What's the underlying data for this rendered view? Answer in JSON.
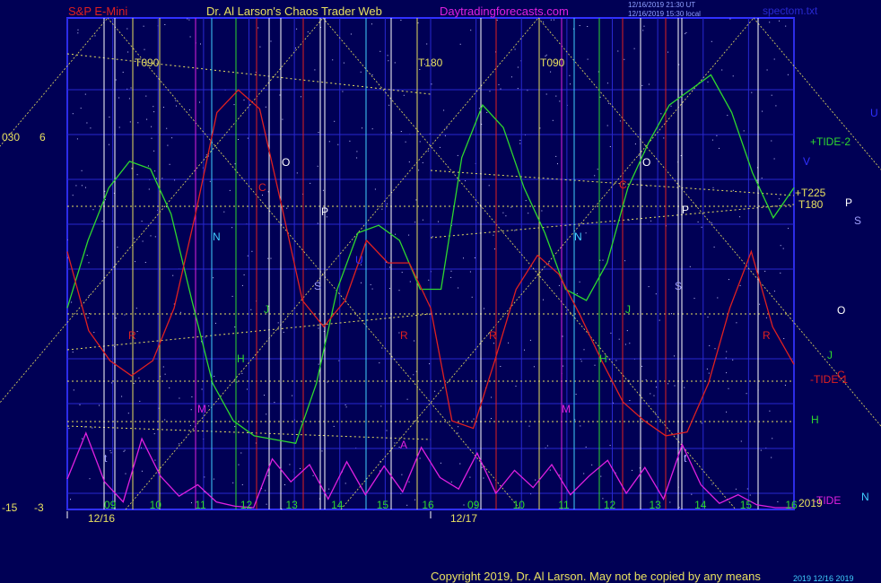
{
  "header": {
    "symbol": "S&P E-Mini",
    "title": "Dr. Al Larson's Chaos Trader Web",
    "site": "Daytradingforecasts.com",
    "stamp_line1": "12/16/2019 21:30 UT",
    "stamp_line2": "12/16/2019 15:30 local",
    "file": "spectom.txt"
  },
  "footer": {
    "copyright": "Copyright 2019, Dr. Al Larson. May not be copied by any means",
    "stamp": "2019 12/16 2019"
  },
  "colors": {
    "background": "#000055",
    "plot_border": "#3030ff",
    "grid_blue": "#2828d0",
    "green_tide": "#2ed82e",
    "red_price": "#e02020",
    "magenta_cycle": "#e020e0",
    "yellow": "#e8e060",
    "cyan": "#40d0ff",
    "white": "#ffffff"
  },
  "chart_data": {
    "type": "line",
    "x_tick_labels": [
      "09",
      "10",
      "11",
      "12",
      "13",
      "14",
      "15",
      "16",
      "09",
      "10",
      "11",
      "12",
      "13",
      "14",
      "15",
      "16"
    ],
    "x_date_labels": [
      "12/16",
      "12/17"
    ],
    "y_labels_left": {
      "top": [
        "030",
        "6"
      ],
      "bottom": [
        "-15",
        "-3"
      ]
    },
    "right_labels": {
      "tide2": "+TIDE-2",
      "t225": "+T225",
      "t180": "T180",
      "tide1": "-TIDE-1",
      "tide": "-TIDE",
      "h": "H",
      "p": "P",
      "s": "S",
      "o": "O",
      "j": "J",
      "c": "C",
      "u": "U",
      "v": "V",
      "n": "N",
      "year": "2019"
    },
    "top_labels": [
      "T090",
      "T180",
      "T090"
    ],
    "vline_letters": [
      "O",
      "P",
      "C",
      "N",
      "U",
      "S",
      "J",
      "H",
      "M",
      "R",
      "A",
      "t"
    ],
    "series": [
      {
        "color": "#2ed82e",
        "values": [
          -1.0,
          0.8,
          2.2,
          2.9,
          2.7,
          1.5,
          -0.8,
          -3.0,
          -4.0,
          -4.4,
          -4.5,
          -4.6,
          -3.0,
          -0.5,
          1.0,
          1.2,
          0.8,
          -0.5,
          -0.5,
          3.0,
          4.4,
          3.8,
          2.2,
          1.0,
          -0.5,
          -0.8,
          0.2,
          2.2,
          3.4,
          4.4,
          4.8,
          5.2,
          4.2,
          2.6,
          1.4,
          2.2
        ]
      },
      {
        "color": "#e02020",
        "values": [
          0.5,
          -1.6,
          -2.4,
          -2.8,
          -2.4,
          -1.0,
          1.5,
          4.2,
          4.8,
          4.3,
          1.8,
          -0.8,
          -1.5,
          -0.8,
          0.8,
          0.2,
          0.2,
          -1.0,
          -4.0,
          -4.2,
          -2.4,
          -0.5,
          0.4,
          -0.1,
          -1.2,
          -2.4,
          -3.5,
          -4.0,
          -4.4,
          -4.3,
          -3.0,
          -1.0,
          0.5,
          -1.5,
          -2.5
        ]
      },
      {
        "color": "#e020e0",
        "values": [
          2.0,
          5.2,
          1.8,
          0.4,
          4.8,
          2.2,
          0.8,
          1.6,
          0.4,
          0.1,
          0.0,
          3.4,
          1.8,
          3.0,
          0.6,
          3.2,
          0.9,
          2.9,
          1.1,
          4.2,
          2.1,
          1.3,
          3.8,
          1.0,
          2.6,
          1.4,
          3.0,
          0.9,
          2.2,
          3.3,
          1.0,
          2.8,
          0.6,
          4.4,
          1.6,
          0.3,
          0.9,
          0.2,
          0.0,
          0.0
        ]
      }
    ]
  }
}
